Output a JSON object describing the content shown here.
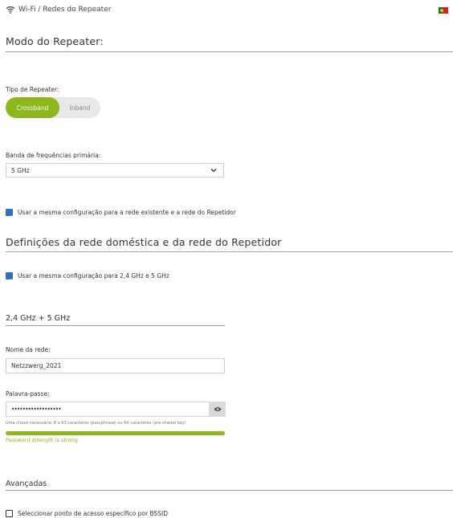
{
  "breadcrumb": {
    "text": "Wi-Fi / Redes do Repeater"
  },
  "section_mode": {
    "title": "Modo do Repeater:"
  },
  "repeater_type": {
    "label": "Tipo de Repeater:",
    "options": [
      "Crossband",
      "Inband"
    ],
    "selected": "Crossband"
  },
  "primary_band": {
    "label": "Banda de frequências primária:",
    "value": "5 GHz"
  },
  "same_config_existing": {
    "label": "Usar a mesma configuração para a rede existente e a rede do Repetidor",
    "checked": true
  },
  "section_networks": {
    "title": "Definições da rede doméstica e da rede do Repetidor"
  },
  "same_config_bands": {
    "label": "Usar a mesma configuração para 2,4 GHz e 5 GHz",
    "checked": true
  },
  "band_heading": {
    "title": "2,4 GHz + 5 GHz"
  },
  "network_name": {
    "label": "Nome da rede:",
    "value": "Netzzwerg_2021"
  },
  "password": {
    "label": "Palavra-passe:",
    "value": "••••••••••••••••••",
    "hint": "Uma chave necessária: 8 a 63 caracteres (passphrase) ou 64 caracteres (pre-shared key)",
    "strength_text": "Password strength is strong",
    "strength_fraction": 1.0
  },
  "advanced": {
    "title": "Avançadas"
  },
  "bssid": {
    "label": "Seleccionar ponto de acesso específico por BSSID",
    "checked": false
  },
  "colors": {
    "accent": "#8cb81e",
    "checkbox": "#2f6fc0"
  }
}
